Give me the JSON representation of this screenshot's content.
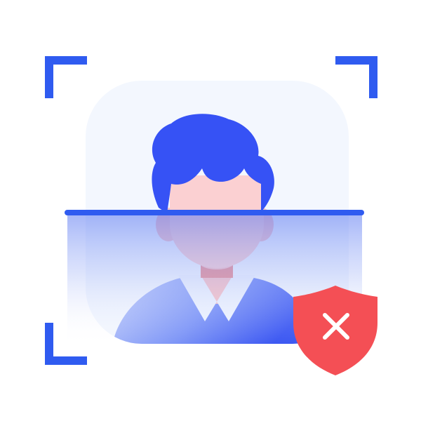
{
  "illustration": {
    "name": "face-scan-failed",
    "icons": [
      "scan-frame-icon",
      "person-avatar-icon",
      "scan-line-icon",
      "shield-x-icon"
    ],
    "status": "failed"
  },
  "colors": {
    "accent": "#2F5BF0",
    "hair": "#3652F5",
    "skin": "#FBD0D2",
    "panel": "#F3F7FE",
    "shirt_light": "#B8C6FA",
    "shirt_dark": "#3A56F2",
    "collar": "#EEF3FE",
    "shield": "#F44F55",
    "shield_mark": "#FFFFFF"
  }
}
